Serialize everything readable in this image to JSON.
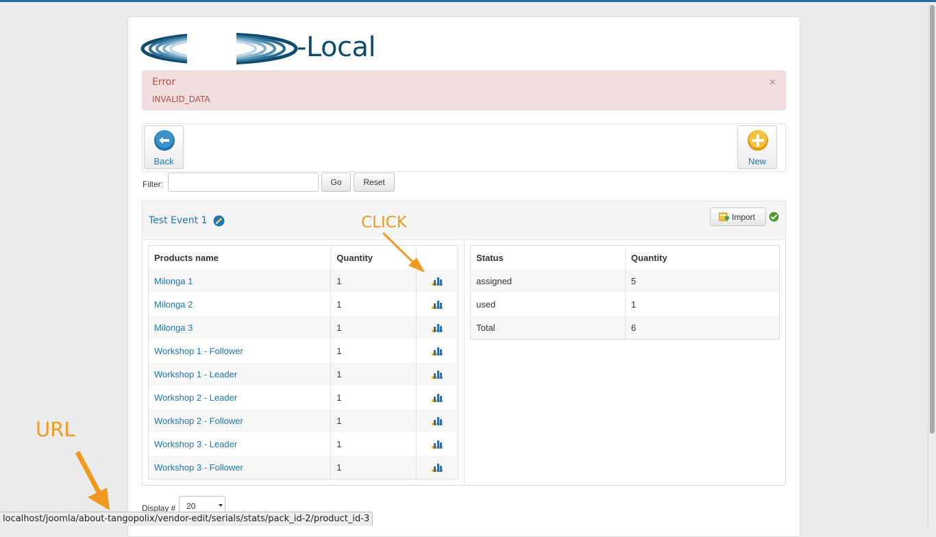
{
  "logo": {
    "text": "-Local",
    "mark_icon": "spiral-logo-mark"
  },
  "alert": {
    "title": "Error",
    "message": "INVALID_DATA",
    "close": "×"
  },
  "toolbar": {
    "back_label": "Back",
    "new_label": "New"
  },
  "filter": {
    "label": "Filter:",
    "value": "",
    "go_label": "Go",
    "reset_label": "Reset"
  },
  "event": {
    "title": "Test Event 1",
    "import_label": "Import"
  },
  "products_table": {
    "headers": [
      "Products name",
      "Quantity",
      ""
    ],
    "rows": [
      {
        "name": "Milonga 1",
        "quantity": "1"
      },
      {
        "name": "Milonga 2",
        "quantity": "1"
      },
      {
        "name": "Milonga 3",
        "quantity": "1"
      },
      {
        "name": "Workshop 1 - Follower",
        "quantity": "1"
      },
      {
        "name": "Workshop 1 - Leader",
        "quantity": "1"
      },
      {
        "name": "Workshop 2 - Leader",
        "quantity": "1"
      },
      {
        "name": "Workshop 2 - Follower",
        "quantity": "1"
      },
      {
        "name": "Workshop 3 - Leader",
        "quantity": "1"
      },
      {
        "name": "Workshop 3 - Follower",
        "quantity": "1"
      }
    ]
  },
  "status_table": {
    "headers": [
      "Status",
      "Quantity"
    ],
    "rows": [
      {
        "status": "assigned",
        "quantity": "5"
      },
      {
        "status": "used",
        "quantity": "1"
      },
      {
        "status": "Total",
        "quantity": "6"
      }
    ]
  },
  "display": {
    "label": "Display #",
    "value": "20"
  },
  "statusbar": {
    "url": "localhost/joomla/about-tangopolix/vendor-edit/serials/stats/pack_id-2/product_id-3"
  },
  "annotations": {
    "click": "CLICK",
    "url": "URL"
  },
  "colors": {
    "accent": "#ef9a1f",
    "link": "#1a77b5",
    "error_bg": "#f2dede",
    "error_text": "#b94a48"
  }
}
